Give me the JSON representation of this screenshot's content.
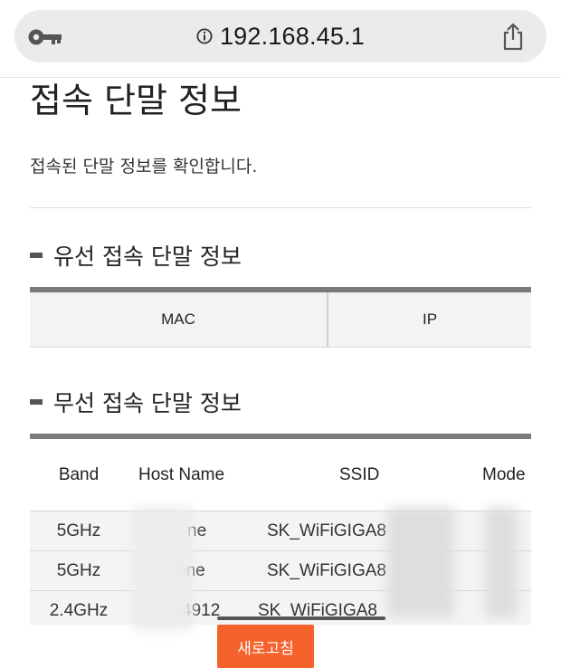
{
  "browser": {
    "url": "192.168.45.1",
    "icons": {
      "left": "key-icon",
      "info": "info-icon",
      "right": "share-icon"
    }
  },
  "page": {
    "title": "접속 단말 정보",
    "description": "접속된 단말 정보를 확인합니다."
  },
  "wired": {
    "title": "유선 접속 단말 정보",
    "columns": [
      "MAC",
      "IP"
    ]
  },
  "wireless": {
    "title": "무선 접속 단말 정보",
    "columns": [
      "Band",
      "Host Name",
      "SSID",
      "Mode"
    ],
    "rows": [
      {
        "band": "5GHz",
        "host": "ne",
        "ssid": "SK_WiFiGIGA8"
      },
      {
        "band": "5GHz",
        "host": "one",
        "ssid": "SK_WiFiGIGA8"
      },
      {
        "band": "2.4GHz",
        "host": "4912",
        "ssid": "SK_WiFiGIGA8"
      }
    ]
  },
  "refresh_label": "새로고침",
  "colors": {
    "accent": "#f5622b",
    "table_rule": "#7a7a7a"
  }
}
